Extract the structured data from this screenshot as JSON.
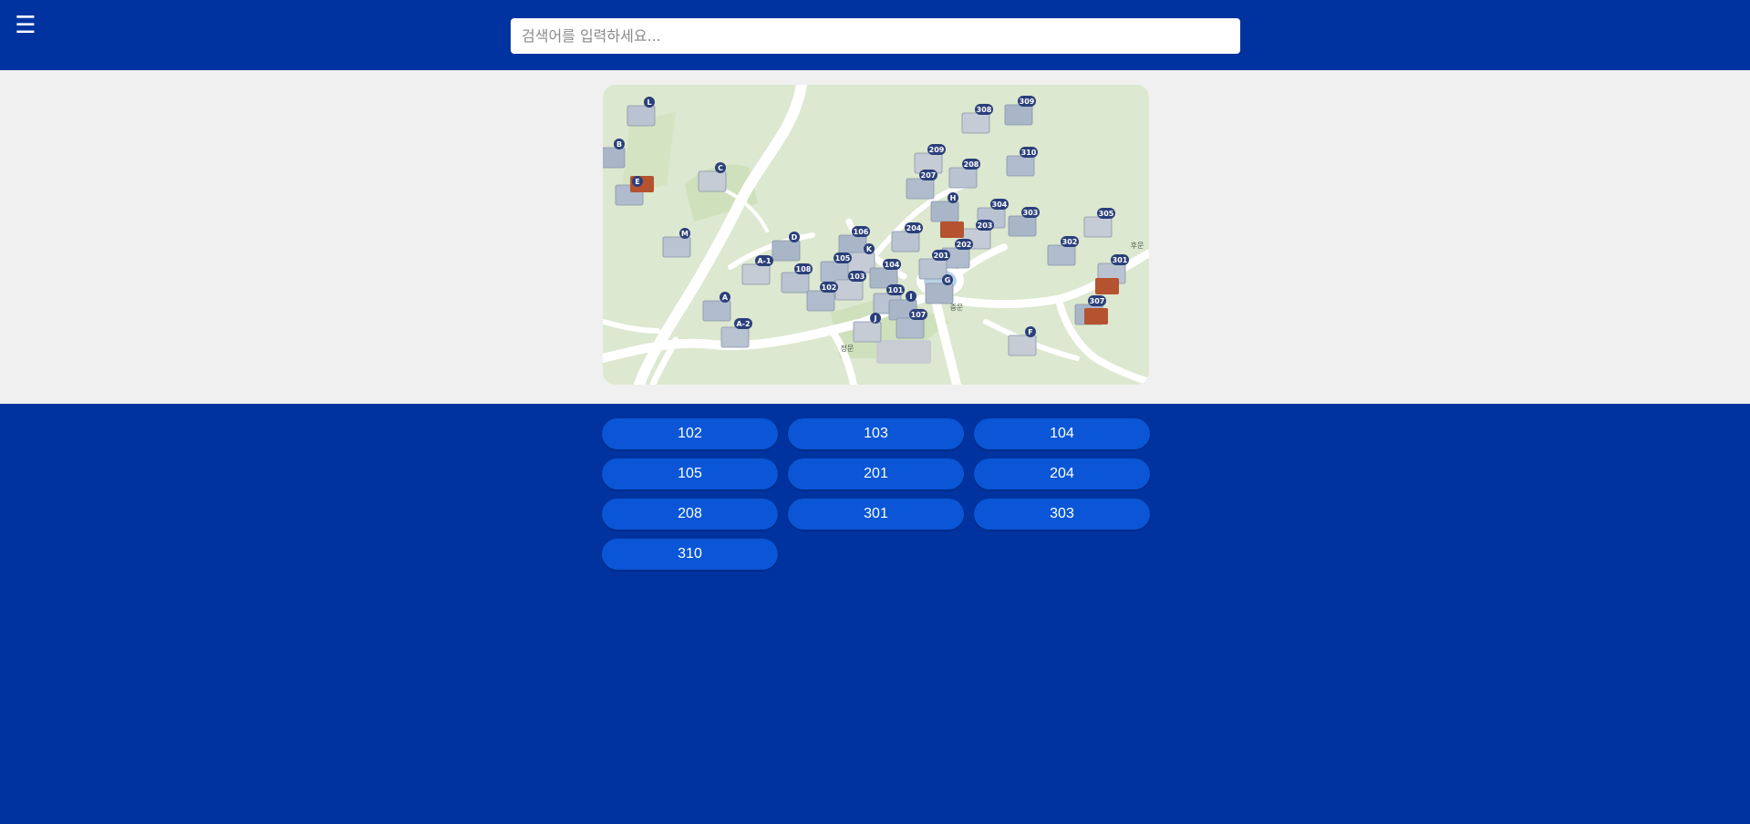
{
  "header": {
    "menu_icon": "hamburger-icon",
    "menu_glyph": "☰",
    "search_placeholder": "검색어를 입력하세요..."
  },
  "map": {
    "labels": [
      "L",
      "B",
      "C",
      "E",
      "M",
      "D",
      "A-1",
      "A",
      "A-2",
      "106",
      "K",
      "105",
      "108",
      "104",
      "103",
      "102",
      "101",
      "I",
      "J",
      "107",
      "204",
      "H",
      "209",
      "207",
      "208",
      "309",
      "308",
      "310",
      "304",
      "303",
      "203",
      "202",
      "201",
      "G",
      "305",
      "302",
      "301",
      "307",
      "F"
    ],
    "gate_labels": [
      "정문",
      "중문",
      "후문"
    ]
  },
  "buildings": [
    "102",
    "103",
    "104",
    "105",
    "201",
    "204",
    "208",
    "301",
    "303",
    "310"
  ],
  "colors": {
    "header_bg": "#0033a0",
    "button_bg": "#0a56d6",
    "map_bg": "#dce8cf",
    "marker": "#2b3f7a"
  }
}
